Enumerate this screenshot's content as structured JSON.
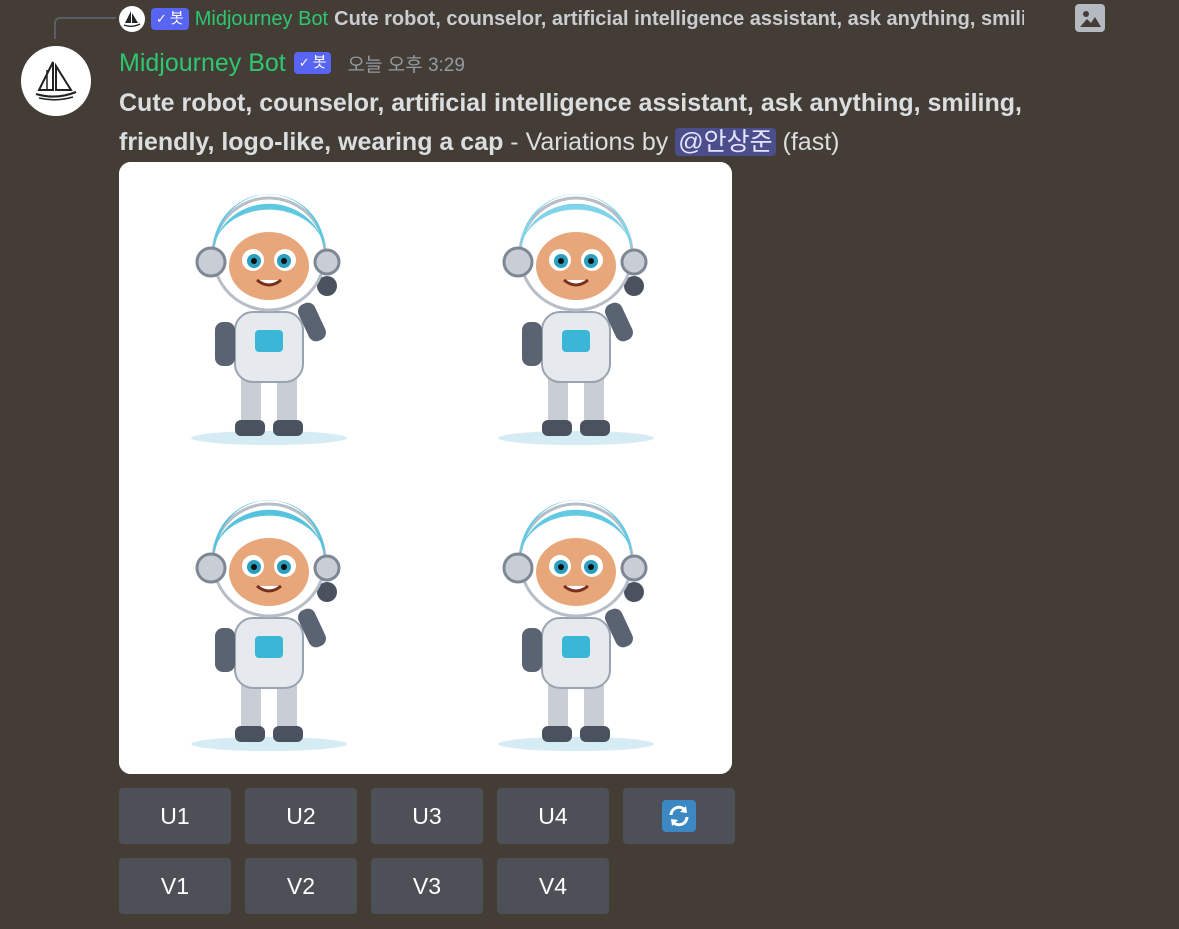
{
  "reply": {
    "author": "Midjourney Bot",
    "badge": "봇",
    "snippet": "Cute robot, counselor, artificial intelligence assistant, ask anything, smiling, friendly, logo-like, wearing a cap",
    "icon": "image-icon"
  },
  "message": {
    "author": "Midjourney Bot",
    "badge": "봇",
    "timestamp": "오늘 오후 3:29",
    "prompt": "Cute robot, counselor, artificial intelligence assistant, ask anything, smiling, friendly, logo-like, wearing a cap",
    "suffix": " - Variations by ",
    "mention": "@안상준",
    "mode": " (fast)"
  },
  "buttons": {
    "upscale": [
      "U1",
      "U2",
      "U3",
      "U4"
    ],
    "reroll_icon": "refresh-icon",
    "variation": [
      "V1",
      "V2",
      "V3",
      "V4"
    ]
  },
  "colors": {
    "background": "#433d36",
    "author": "#2dc770",
    "badge": "#5865f2",
    "button": "#4e5058",
    "mention": "#4c4e8c"
  }
}
